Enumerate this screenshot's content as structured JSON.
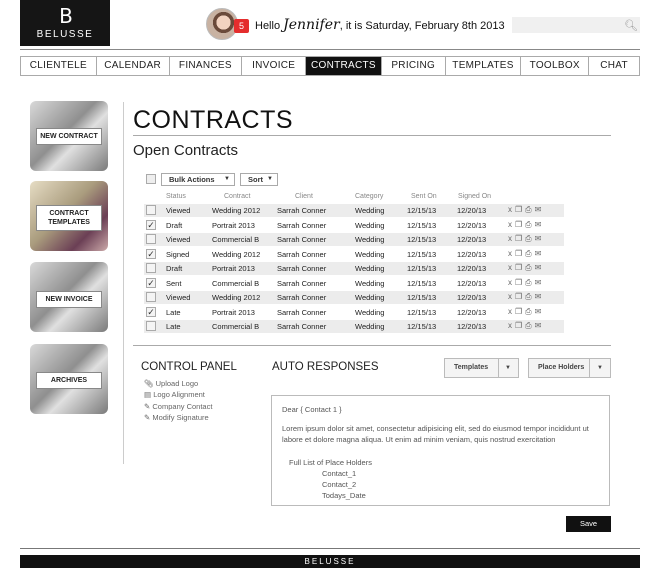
{
  "brand": {
    "mark": "B",
    "name": "BELUSSE"
  },
  "header": {
    "notification_count": "5",
    "hello": "Hello",
    "user": "Jennifer",
    "date_prefix": ", it is",
    "date": "Saturday, February 8th 2013",
    "search_placeholder": "",
    "search_icon": "magnifier-icon"
  },
  "nav": {
    "tabs": [
      "CLIENTELE",
      "CALENDAR",
      "FINANCES",
      "INVOICE",
      "CONTRACTS",
      "PRICING",
      "TEMPLATES",
      "TOOLBOX",
      "CHAT"
    ],
    "active": "CONTRACTS"
  },
  "sidebar": {
    "new_contract": "NEW CONTRACT",
    "templates_line1": "CONTRACT",
    "templates_line2": "TEMPLATES",
    "new_invoice": "NEW INVOICE",
    "archives": "ARCHIVES"
  },
  "main": {
    "title": "CONTRACTS",
    "section": "Open Contracts",
    "bulk_actions": "Bulk Actions",
    "sort": "Sort",
    "columns": [
      "Status",
      "Contract",
      "Client",
      "Category",
      "Sent On",
      "Signed On"
    ],
    "rows": [
      {
        "checked": false,
        "status": "Viewed",
        "contract": "Wedding 2012",
        "client": "Sarrah Conner",
        "category": "Wedding",
        "sent": "12/15/13",
        "signed": "12/20/13"
      },
      {
        "checked": true,
        "status": "Draft",
        "contract": "Portrait 2013",
        "client": "Sarrah Conner",
        "category": "Wedding",
        "sent": "12/15/13",
        "signed": "12/20/13"
      },
      {
        "checked": false,
        "status": "Viewed",
        "contract": "Commercial B",
        "client": "Sarrah Conner",
        "category": "Wedding",
        "sent": "12/15/13",
        "signed": "12/20/13"
      },
      {
        "checked": true,
        "status": "Signed",
        "contract": "Wedding 2012",
        "client": "Sarrah Conner",
        "category": "Wedding",
        "sent": "12/15/13",
        "signed": "12/20/13"
      },
      {
        "checked": false,
        "status": "Draft",
        "contract": "Portrait 2013",
        "client": "Sarrah Conner",
        "category": "Wedding",
        "sent": "12/15/13",
        "signed": "12/20/13"
      },
      {
        "checked": true,
        "status": "Sent",
        "contract": "Commercial B",
        "client": "Sarrah Conner",
        "category": "Wedding",
        "sent": "12/15/13",
        "signed": "12/20/13"
      },
      {
        "checked": false,
        "status": "Viewed",
        "contract": "Wedding 2012",
        "client": "Sarrah Conner",
        "category": "Wedding",
        "sent": "12/15/13",
        "signed": "12/20/13"
      },
      {
        "checked": true,
        "status": "Late",
        "contract": "Portrait 2013",
        "client": "Sarrah Conner",
        "category": "Wedding",
        "sent": "12/15/13",
        "signed": "12/20/13"
      },
      {
        "checked": false,
        "status": "Late",
        "contract": "Commercial B",
        "client": "Sarrah Conner",
        "category": "Wedding",
        "sent": "12/15/13",
        "signed": "12/20/13"
      }
    ],
    "row_actions": [
      "delete-icon",
      "copy-icon",
      "print-icon",
      "email-icon"
    ]
  },
  "control_panel": {
    "title": "CONTROL PANEL",
    "links": [
      "Upload Logo",
      "Logo Alignment",
      "Company Contact",
      "Modify Signature"
    ]
  },
  "auto_responses": {
    "title": "AUTO RESPONSES",
    "templates": "Templates",
    "placeholders": "Place Holders",
    "greeting": "Dear { Contact 1 }",
    "body": "Lorem ipsum dolor sit amet, consectetur adipisicing elit, sed do eiusmod tempor incididunt ut labore et dolore magna aliqua. Ut enim ad minim veniam, quis nostrud exercitation",
    "placeholder_header": "Full List of Place Holders",
    "placeholder_items": [
      "Contact_1",
      "Contact_2",
      "Todays_Date"
    ],
    "save": "Save"
  },
  "footer": {
    "brand": "BELUSSE"
  }
}
